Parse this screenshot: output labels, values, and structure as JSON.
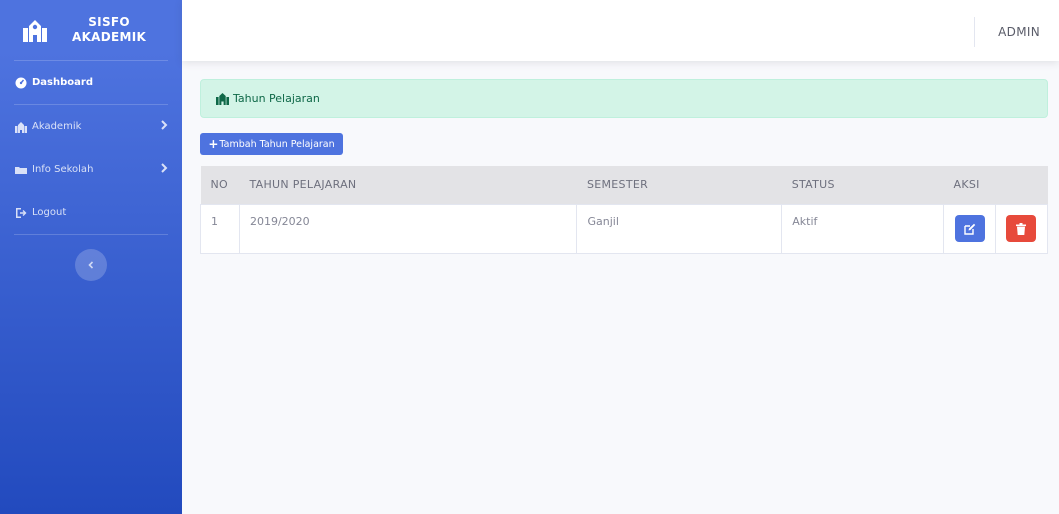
{
  "sidebar": {
    "brand_line1": "SISFO",
    "brand_line2": "AKADEMIK",
    "items": [
      {
        "label": "Dashboard",
        "icon": "tachometer-icon"
      },
      {
        "label": "Akademik",
        "icon": "school-icon"
      },
      {
        "label": "Info Sekolah",
        "icon": "folder-icon"
      },
      {
        "label": "Logout",
        "icon": "sign-out-icon"
      }
    ]
  },
  "topbar": {
    "user": "ADMIN"
  },
  "alert": {
    "text": "Tahun Pelajaran"
  },
  "actions": {
    "add_label": "Tambah Tahun Pelajaran"
  },
  "table": {
    "headers": [
      "NO",
      "TAHUN PELAJARAN",
      "SEMESTER",
      "STATUS",
      "AKSI"
    ],
    "rows": [
      [
        "1",
        "2019/2020",
        "Ganjil",
        "Aktif"
      ]
    ]
  },
  "colors": {
    "primary": "#4e73df",
    "danger": "#e74a3b",
    "success_bg": "#d3f4e7"
  }
}
